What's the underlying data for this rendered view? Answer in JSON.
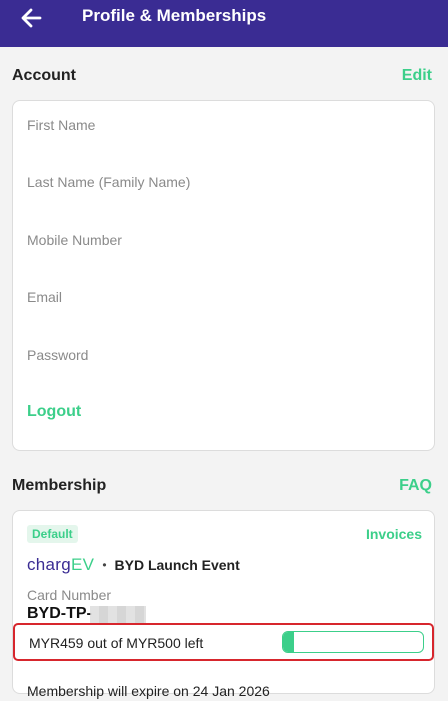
{
  "appbar": {
    "title": "Profile & Memberships",
    "back_icon": "arrow-left-icon"
  },
  "account": {
    "heading": "Account",
    "edit_label": "Edit",
    "fields": {
      "first_name": "First Name",
      "last_name": "Last Name (Family Name)",
      "mobile": "Mobile Number",
      "email": "Email",
      "password": "Password"
    },
    "logout_label": "Logout"
  },
  "membership": {
    "heading": "Membership",
    "faq_label": "FAQ",
    "card": {
      "badge": "Default",
      "invoices_label": "Invoices",
      "brand_part1": "charg",
      "brand_part2": "EV",
      "separator": "•",
      "event": "BYD Launch Event",
      "card_number_label": "Card Number",
      "card_number_value": "BYD-TP-",
      "balance_text": "MYR459 out of MYR500 left",
      "balance_remaining_fraction": 0.08,
      "expiry_text": "Membership will expire on 24 Jan 2026"
    }
  },
  "colors": {
    "appbar": "#3a2c93",
    "accent": "#3ccf8a",
    "highlight": "#d7262d"
  }
}
